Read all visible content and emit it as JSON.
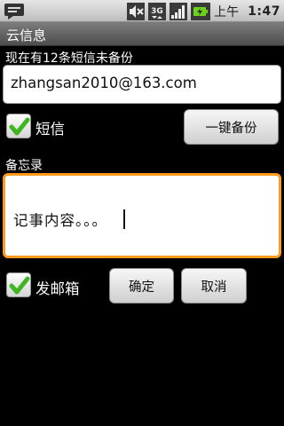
{
  "status_bar": {
    "icons": [
      "notification-icon",
      "mute-icon",
      "3g-signal-icon",
      "signal-strength-icon",
      "battery-icon"
    ],
    "network_label": "3G",
    "ampm": "上午",
    "time": "1:47"
  },
  "title_bar": {
    "title": "云信息"
  },
  "info": {
    "text": "现在有12条短信未备份"
  },
  "email": {
    "value": "zhangsan2010@163.com"
  },
  "sms": {
    "label": "短信",
    "checked": true
  },
  "backup_button": {
    "label": "一键备份"
  },
  "memo": {
    "label": "备忘录",
    "content": "记事内容。。。"
  },
  "outbox": {
    "label": "发邮箱",
    "checked": true
  },
  "buttons": {
    "confirm": "确定",
    "cancel": "取消"
  },
  "colors": {
    "focus_border": "#ff9a1a",
    "check_green": "#3fb51f"
  }
}
